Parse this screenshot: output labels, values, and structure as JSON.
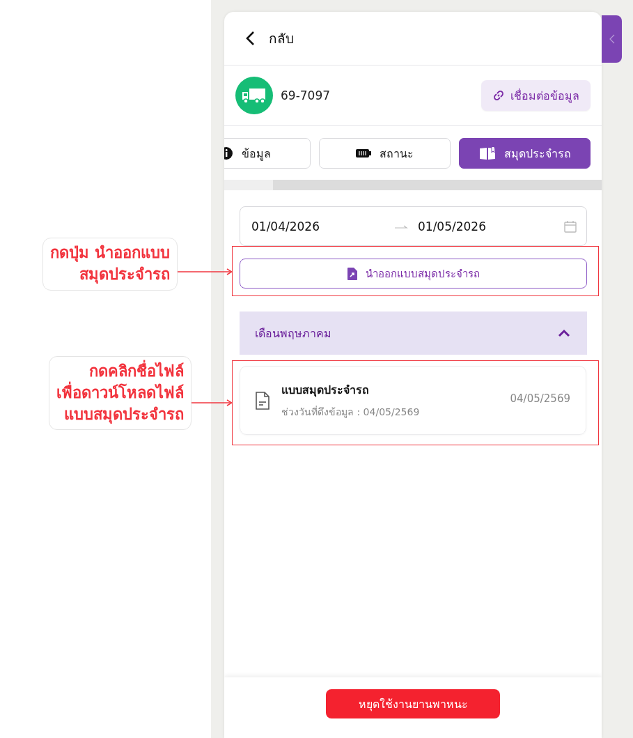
{
  "header": {
    "back_label": "กลับ"
  },
  "vehicle": {
    "plate": "69-7097",
    "link_button": "เชื่อมต่อข้อมูล"
  },
  "tabs": [
    {
      "kind": "info",
      "label": "ข้อมูล",
      "selected": false
    },
    {
      "kind": "status",
      "label": "สถานะ",
      "selected": false
    },
    {
      "kind": "logbook",
      "label": "สมุดประจำรถ",
      "selected": true
    }
  ],
  "date_range": {
    "start": "01/04/2026",
    "end": "01/05/2026"
  },
  "export_button": "นำออกแบบสมุดประจำรถ",
  "month_group": {
    "title": "เดือนพฤษภาคม",
    "expanded": true,
    "files": [
      {
        "name": "แบบสมุดประจำรถ",
        "subtitle": "ช่วงวันที่ดึงข้อมูล : 04/05/2569",
        "date": "04/05/2569"
      }
    ]
  },
  "footer_button": "หยุดใช้งานยานพาหนะ",
  "annotations": [
    {
      "lines": [
        "กดปุ่ม นำออกแบบ",
        "สมุดประจำรถ"
      ]
    },
    {
      "lines": [
        "กดคลิกชื่อไฟล์",
        "เพื่อดาวน์โหลดไฟล์",
        "แบบสมุดประจำรถ"
      ]
    }
  ]
}
